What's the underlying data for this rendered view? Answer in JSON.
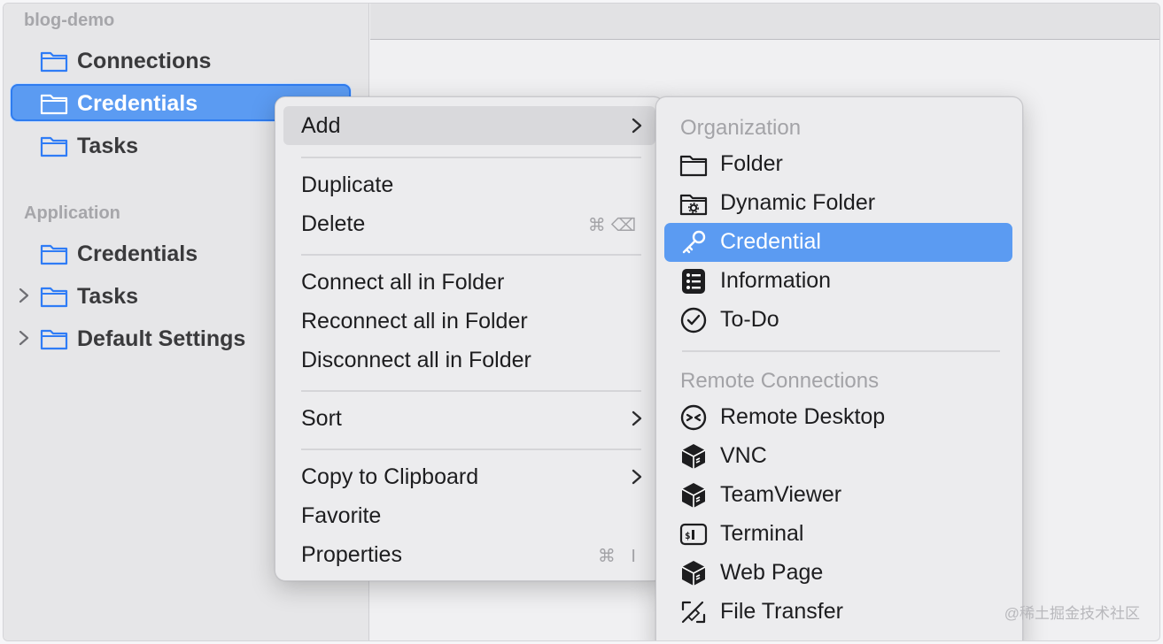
{
  "sidebar": {
    "project_title": "blog-demo",
    "project_items": [
      {
        "label": "Connections",
        "icon": "folder-icon"
      },
      {
        "label": "Credentials",
        "icon": "folder-icon",
        "selected": true
      },
      {
        "label": "Tasks",
        "icon": "folder-icon"
      }
    ],
    "application_title": "Application",
    "application_items": [
      {
        "label": "Credentials",
        "icon": "folder-icon"
      },
      {
        "label": "Tasks",
        "icon": "folder-icon",
        "expandable": true
      },
      {
        "label": "Default Settings",
        "icon": "folder-icon",
        "expandable": true
      }
    ]
  },
  "context_menu": {
    "add": "Add",
    "duplicate": "Duplicate",
    "delete": "Delete",
    "delete_shortcut": "⌘⌫",
    "connect_all": "Connect all in Folder",
    "reconnect_all": "Reconnect all in Folder",
    "disconnect_all": "Disconnect all in Folder",
    "sort": "Sort",
    "copy_to_clipboard": "Copy to Clipboard",
    "favorite": "Favorite",
    "properties": "Properties",
    "properties_shortcut": "⌘ I"
  },
  "submenu": {
    "organization_header": "Organization",
    "folder": "Folder",
    "dynamic_folder": "Dynamic Folder",
    "credential": "Credential",
    "information": "Information",
    "todo": "To-Do",
    "remote_header": "Remote Connections",
    "remote_desktop": "Remote Desktop",
    "vnc": "VNC",
    "teamviewer": "TeamViewer",
    "terminal": "Terminal",
    "web_page": "Web Page",
    "file_transfer": "File Transfer"
  },
  "watermark": "@稀土掘金技术社区",
  "colors": {
    "accent": "#5b9bf2",
    "folder_icon": "#2f7cf6"
  }
}
